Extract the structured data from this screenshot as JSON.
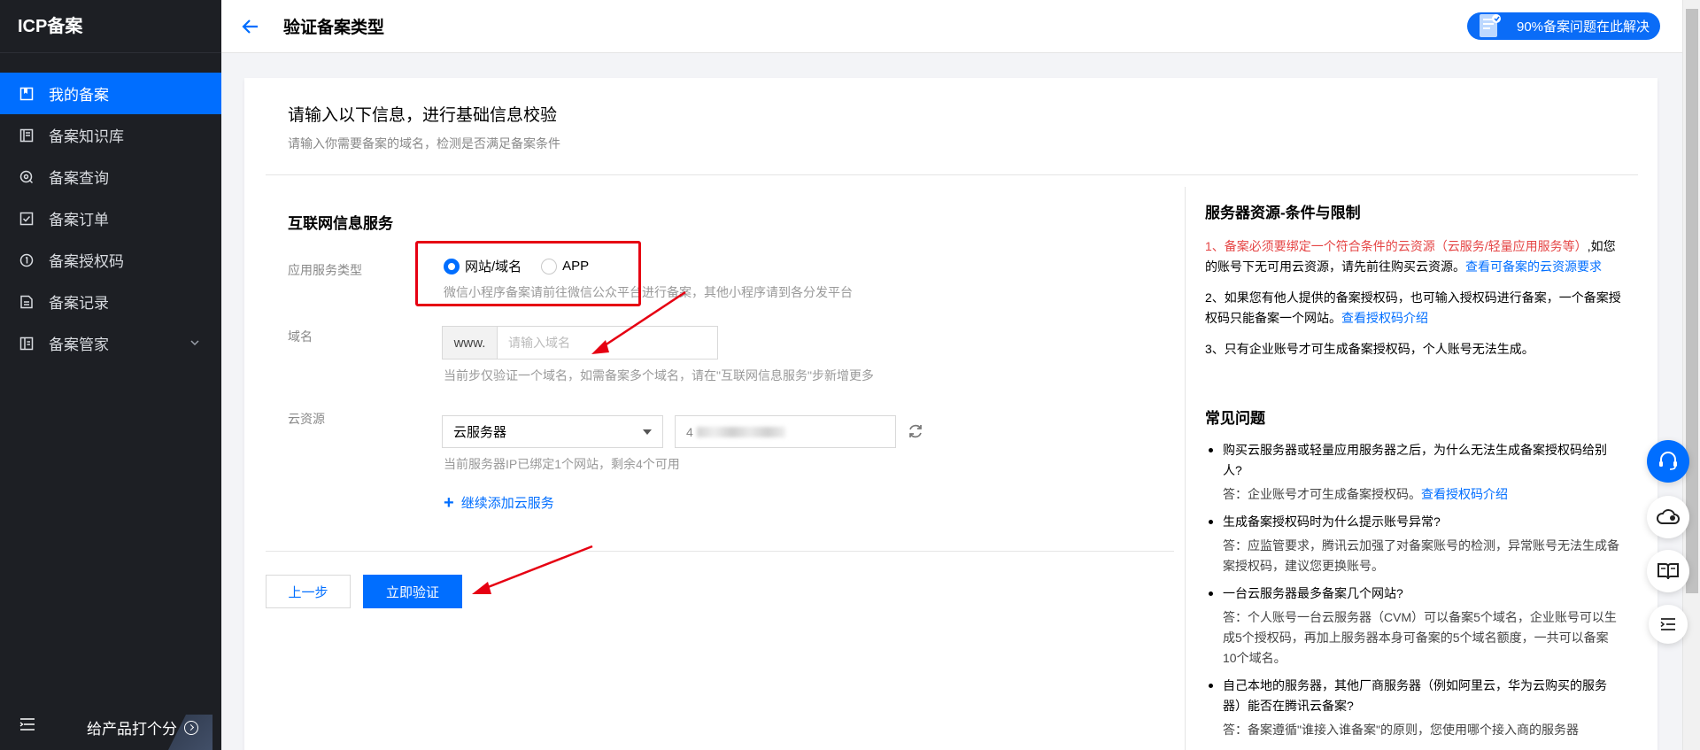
{
  "sidebar": {
    "title": "ICP备案",
    "items": [
      {
        "label": "我的备案",
        "icon": "bookmark-icon"
      },
      {
        "label": "备案知识库",
        "icon": "book-icon"
      },
      {
        "label": "备案查询",
        "icon": "search-icon"
      },
      {
        "label": "备案订单",
        "icon": "checkbox-icon"
      },
      {
        "label": "备案授权码",
        "icon": "info-icon"
      },
      {
        "label": "备案记录",
        "icon": "document-icon"
      },
      {
        "label": "备案管家",
        "icon": "toolbox-icon"
      }
    ],
    "rate_label": "给产品打个分"
  },
  "header": {
    "title": "验证备案类型",
    "help_label": "90%备案问题在此解决"
  },
  "intro": {
    "title": "请输入以下信息，进行基础信息校验",
    "subtitle": "请输入你需要备案的域名，检测是否满足备案条件"
  },
  "form": {
    "section_title": "互联网信息服务",
    "service_type_label": "应用服务类型",
    "radio_website": "网站/域名",
    "radio_app": "APP",
    "service_hint": "微信小程序备案请前往微信公众平台进行备案，其他小程序请到各分发平台",
    "domain_label": "域名",
    "domain_prefix": "www.",
    "domain_placeholder": "请输入域名",
    "domain_hint": "当前步仅验证一个域名，如需备案多个域名，请在\"互联网信息服务\"步新增更多",
    "cloud_label": "云资源",
    "cloud_select": "云服务器",
    "cloud_value_prefix": "4",
    "cloud_hint": "当前服务器IP已绑定1个网站，剩余4个可用",
    "add_more": "继续添加云服务",
    "prev_button": "上一步",
    "verify_button": "立即验证"
  },
  "right": {
    "title": "服务器资源-条件与限制",
    "p1_num": "1、",
    "p1_red": "备案必须要绑定一个符合条件的云资源（云服务/轻量应用服务等）",
    "p1_text": ",如您的账号下无可用云资源，请先前往购买云资源。",
    "p1_link": "查看可备案的云资源要求",
    "p2_text": "2、如果您有他人提供的备案授权码，也可输入授权码进行备案，一个备案授权码只能备案一个网站。",
    "p2_link": "查看授权码介绍",
    "p3_text": "3、只有企业账号才可生成备案授权码，个人账号无法生成。",
    "faq_title": "常见问题",
    "faq": [
      {
        "q": "购买云服务器或轻量应用服务器之后，为什么无法生成备案授权码给别人?",
        "a": "答：企业账号才可生成备案授权码。",
        "link": "查看授权码介绍"
      },
      {
        "q": "生成备案授权码时为什么提示账号异常?",
        "a": "答：应监管要求，腾讯云加强了对备案账号的检测，异常账号无法生成备案授权码，建议您更换账号。",
        "link": ""
      },
      {
        "q": "一台云服务器最多备案几个网站?",
        "a": "答：个人账号一台云服务器（CVM）可以备案5个域名，企业账号可以生成5个授权码，再加上服务器本身可备案的5个域名额度，一共可以备案10个域名。",
        "link": ""
      },
      {
        "q": "自己本地的服务器，其他厂商服务器（例如阿里云，华为云购买的服务器）能否在腾讯云备案?",
        "a": "答：备案遵循\"谁接入谁备案\"的原则，您使用哪个接入商的服务器",
        "link": ""
      }
    ]
  },
  "colors": {
    "primary": "#006eff",
    "sidebar_bg": "#1d1f24",
    "highlight_red": "#e60012",
    "warning_red": "#e54545"
  }
}
